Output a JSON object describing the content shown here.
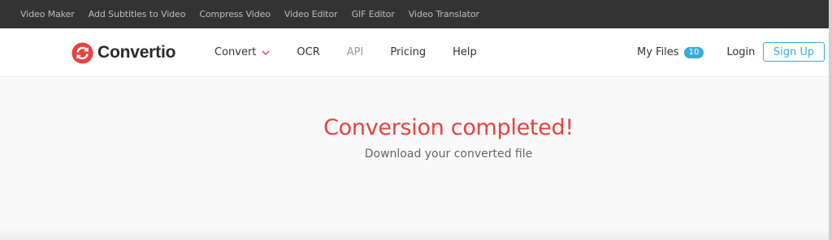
{
  "topbar": {
    "links": [
      "Video Maker",
      "Add Subtitles to Video",
      "Compress Video",
      "Video Editor",
      "GIF Editor",
      "Video Translator"
    ]
  },
  "brand": {
    "name": "Convertio",
    "accent_color": "#e8423f"
  },
  "nav": {
    "convert": "Convert",
    "ocr": "OCR",
    "api": "API",
    "pricing": "Pricing",
    "help": "Help"
  },
  "account": {
    "my_files": "My Files",
    "files_count": "10",
    "login": "Login",
    "signup": "Sign Up",
    "link_color": "#3aaad9"
  },
  "main": {
    "headline": "Conversion completed!",
    "subline": "Download your converted file"
  }
}
